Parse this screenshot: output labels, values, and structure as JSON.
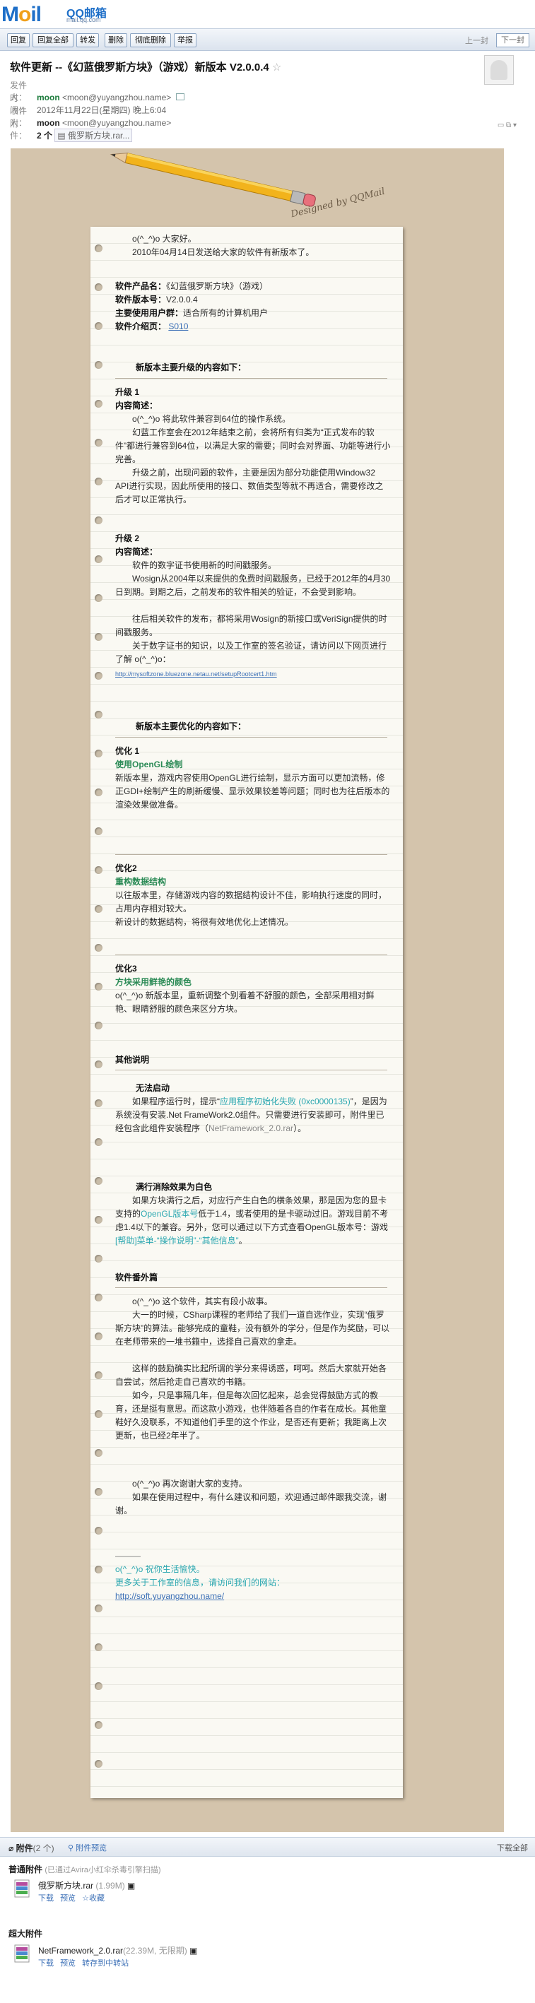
{
  "header": {
    "logo_text": "Mail",
    "brand": "QQ邮箱",
    "url": "mail.qq.com"
  },
  "toolbar": {
    "buttons": [
      "回复",
      "回复全部",
      "转发",
      "删除",
      "彻底删除",
      "举报"
    ],
    "prev": "上一封",
    "next": "下一封"
  },
  "mail": {
    "subject": "软件更新 --《幻蓝俄罗斯方块》（游戏）新版本 V2.0.0.4",
    "star": "☆",
    "sender_label": "发件人：",
    "sender_name": "moon",
    "sender_email": "<moon@yuyangzhou.name>",
    "time_label": "时　间：",
    "time": "2012年11月22日(星期四) 晚上6:04",
    "to_label": "收件人：",
    "to_name": "moon",
    "to_email": "<moon@yuyangzhou.name>",
    "attach_label": "附　件：",
    "attach_count": "2 个",
    "attach_chip": "俄罗斯方块.rar..."
  },
  "paper": {
    "designed": "Designed by QQMail",
    "greeting": "o(^_^)o  大家好。",
    "intro": "2010年04月14日发送给大家的软件有新版本了。",
    "product_k": "软件产品名：",
    "product_v": "《幻蓝俄罗斯方块》（游戏）",
    "version_k": "软件版本号：",
    "version_v": "V2.0.0.4",
    "user_k": "主要使用用户群：",
    "user_v": "适合所有的计算机用户",
    "page_k": "软件介绍页：",
    "page_v": "S010",
    "upgrade_title": "新版本主要升级的内容如下：",
    "u1_title": "升级 1",
    "u1_sub": "内容简述：",
    "u1_p1": "o(^_^)o  将此软件兼容到64位的操作系统。",
    "u1_p2": "幻蓝工作室会在2012年结束之前，会将所有归类为“正式发布的软件”都进行兼容到64位，以满足大家的需要；同时会对界面、功能等进行小完善。",
    "u1_p3": "升级之前，出现问题的软件，主要是因为部分功能使用Window32 API进行实现，因此所使用的接口、数值类型等就不再适合，需要修改之后才可以正常执行。",
    "u2_title": "升级 2",
    "u2_sub": "内容简述：",
    "u2_p1": "软件的数字证书使用新的时间戳服务。",
    "u2_p2": "Wosign从2004年以来提供的免费时间戳服务，已经于2012年的4月30日到期。到期之后，之前发布的软件相关的验证，不会受到影响。",
    "u2_p3": "往后相关软件的发布，都将采用Wosign的新接口或VeriSign提供的时间戳服务。",
    "u2_p4": "关于数字证书的知识，以及工作室的签名验证，请访问以下网页进行了解  o(^_^)o：",
    "u2_link": "http://mysoftzone.bluezone.netau.net/setupRootcert1.htm",
    "opt_title": "新版本主要优化的内容如下：",
    "o1_title": "优化 1",
    "o1_sub": "使用OpenGL绘制",
    "o1_p": "新版本里，游戏内容使用OpenGL进行绘制，显示方面可以更加流畅，修正GDI+绘制产生的刷新缓慢、显示效果较差等问题；同时也为往后版本的渲染效果做准备。",
    "o2_title": "优化2",
    "o2_sub": "重构数据结构",
    "o2_p1": "以往版本里，存储游戏内容的数据结构设计不佳，影响执行速度的同时，占用内存相对较大。",
    "o2_p2": "新设计的数据结构，将很有效地优化上述情况。",
    "o3_title": "优化3",
    "o3_sub": "方块采用鲜艳的颜色",
    "o3_p": "o(^_^)o  新版本里，重新调整个别看着不舒服的颜色，全部采用相对鲜艳、眼睛舒服的颜色来区分方块。",
    "other_title": "其他说明",
    "fail_title": "无法启动",
    "fail_p_a": "如果程序运行时，提示“",
    "fail_p_b": "应用程序初始化失败 (0xc0000135)",
    "fail_p_c": "”，是因为系统没有安装.Net FrameWork2.0组件。只需要进行安装即可，附件里已经包含此组件安装程序（",
    "fail_p_d": "NetFramework_2.0.rar",
    "fail_p_e": "）。",
    "white_title": "满行消除效果为白色",
    "white_p_a": "如果方块满行之后，对应行产生白色的横条效果，那是因为您的显卡支持的",
    "white_p_b": "OpenGL版本号",
    "white_p_c": "低于1.4，或者使用的是卡驱动过旧。游戏目前不考虑1.4以下的兼容。另外，您可以通过以下方式查看OpenGL版本号：游戏",
    "white_p_d": "[帮助]菜单-“操作说明”-“其他信息”",
    "white_p_e": "。",
    "extra_title": "软件番外篇",
    "extra_p1": "o(^_^)o  这个软件，其实有段小故事。",
    "extra_p2": "大一的时候，CSharp课程的老师给了我们一道自选作业，实现“俄罗斯方块”的算法。能够完成的童鞋，没有额外的学分，但是作为奖励，可以在老师带来的一堆书籍中，选择自己喜欢的拿走。",
    "extra_p3": "这样的鼓励确实比起所谓的学分来得诱惑，呵呵。然后大家就开始各自尝试，然后抢走自己喜欢的书籍。",
    "extra_p4": "如今，只是事隔几年，但是每次回忆起来，总会觉得鼓励方式的教育，还是挺有意思。而这款小游戏，也伴随着各自的作者在成长。其他童鞋好久没联系，不知道他们手里的这个作业，是否还有更新；我距离上次更新，也已经2年半了。",
    "thanks": "o(^_^)o  再次谢谢大家的支持。",
    "contact": "如果在使用过程中，有什么建议和问题，欢迎通过邮件跟我交流，谢谢。",
    "sig_line": "———",
    "sig1": "o(^_^)o  祝你生活愉快。",
    "sig2": "更多关于工作室的信息，请访问我们的网站：",
    "sig_link": "http://soft.yuyangzhou.name/"
  },
  "attachments": {
    "title": "附件",
    "count": "(2 个)",
    "preview_all": "附件预览",
    "download_all": "下载全部",
    "normal_group": "普通附件",
    "normal_note": "(已通过Avira小红伞杀毒引擎扫描)",
    "file1_name": "俄罗斯方块.rar",
    "file1_size": "(1.99M)",
    "file1_actions": [
      "下载",
      "预览",
      "收藏"
    ],
    "big_group": "超大附件",
    "file2_name": "NetFramework_2.0.rar",
    "file2_size": "(22.39M, 无限期)",
    "file2_actions": [
      "下载",
      "预览",
      "转存到中转站"
    ]
  },
  "colors": {
    "accent": "#3b6fb6",
    "green": "#2a8a55",
    "cyan": "#2aa7b0",
    "frame": "#d4c4ac"
  }
}
